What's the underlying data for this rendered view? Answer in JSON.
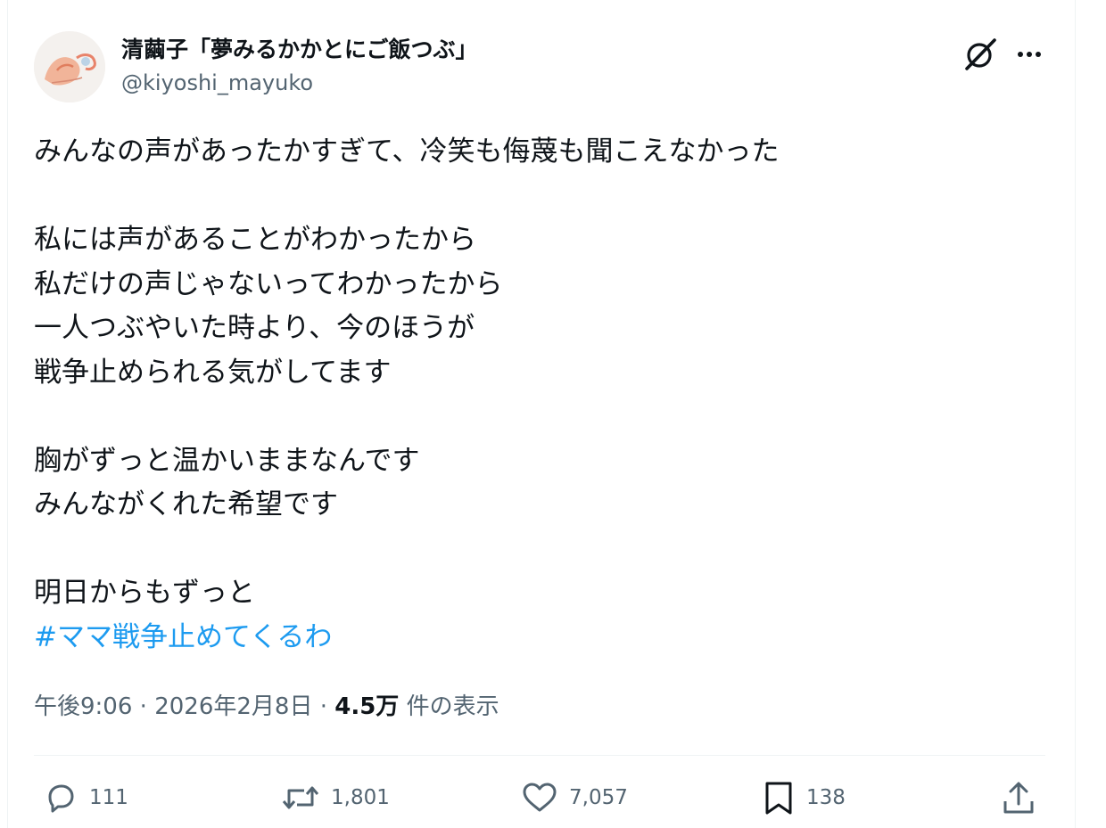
{
  "author": {
    "display_name": "清繭子「夢みるかかとにご飯つぶ」",
    "handle": "@kiyoshi_mayuko"
  },
  "post": {
    "lines": [
      "みんなの声があったかすぎて、冷笑も侮蔑も聞こえなかった",
      "",
      "私には声があることがわかったから",
      "私だけの声じゃないってわかったから",
      "一人つぶやいた時より、今のほうが",
      "戦争止められる気がしてます",
      "",
      "胸がずっと温かいままなんです",
      "みんながくれた希望です",
      "",
      "明日からもずっと"
    ],
    "hashtag": "#ママ戦争止めてくるわ"
  },
  "meta": {
    "time": "午後9:06",
    "separator": "·",
    "date": "2026年2月8日",
    "views_count": "4.5万",
    "views_label": "件の表示"
  },
  "actions": {
    "replies": "111",
    "reposts": "1,801",
    "likes": "7,057",
    "bookmarks": "138"
  },
  "icons": {
    "grok": "grok-icon",
    "more": "more-icon",
    "reply": "reply-icon",
    "repost": "repost-icon",
    "like": "heart-icon",
    "bookmark": "bookmark-icon",
    "share": "share-icon"
  },
  "colors": {
    "text": "#0f1419",
    "secondary": "#536471",
    "link": "#1d9bf0",
    "divider": "#eff3f4"
  }
}
